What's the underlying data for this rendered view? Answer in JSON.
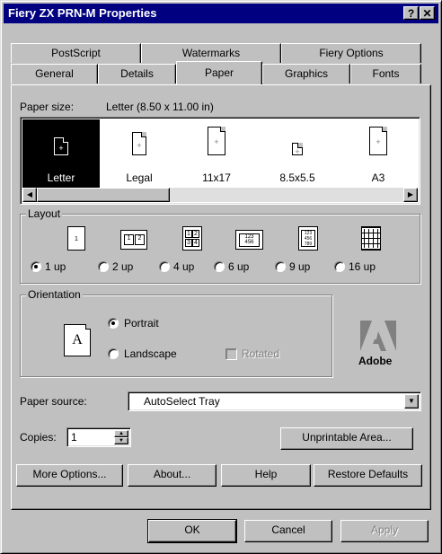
{
  "window": {
    "title": "Fiery ZX PRN-M Properties",
    "help_btn": "?",
    "close_btn": "✕"
  },
  "tabs_back": [
    {
      "label": "PostScript"
    },
    {
      "label": "Watermarks"
    },
    {
      "label": "Fiery Options"
    }
  ],
  "tabs_front": [
    {
      "label": "General"
    },
    {
      "label": "Details"
    },
    {
      "label": "Paper",
      "active": true
    },
    {
      "label": "Graphics"
    },
    {
      "label": "Fonts"
    }
  ],
  "paper": {
    "size_label": "Paper size:",
    "size_value": "Letter (8.50 x 11.00 in)",
    "items": [
      {
        "label": "Letter",
        "selected": true
      },
      {
        "label": "Legal"
      },
      {
        "label": "11x17"
      },
      {
        "label": "8.5x5.5"
      },
      {
        "label": "A3"
      }
    ]
  },
  "layout": {
    "legend": "Layout",
    "options": [
      {
        "label": "1 up",
        "selected": true
      },
      {
        "label": "2 up"
      },
      {
        "label": "4 up"
      },
      {
        "label": "6 up"
      },
      {
        "label": "9 up"
      },
      {
        "label": "16 up"
      }
    ]
  },
  "orientation": {
    "legend": "Orientation",
    "portrait": "Portrait",
    "landscape": "Landscape",
    "rotated": "Rotated",
    "icon_letter": "A"
  },
  "adobe_logo_text": "Adobe",
  "paper_source": {
    "label": "Paper source:",
    "value": "AutoSelect Tray"
  },
  "copies": {
    "label": "Copies:",
    "value": "1"
  },
  "buttons": {
    "unprintable": "Unprintable Area...",
    "more_options": "More Options...",
    "about": "About...",
    "help": "Help",
    "restore": "Restore Defaults",
    "ok": "OK",
    "cancel": "Cancel",
    "apply": "Apply"
  },
  "colors": {
    "titlebar": "#000080",
    "face": "#c0c0c0",
    "selection": "#000000",
    "adobe_red": "#808080"
  }
}
